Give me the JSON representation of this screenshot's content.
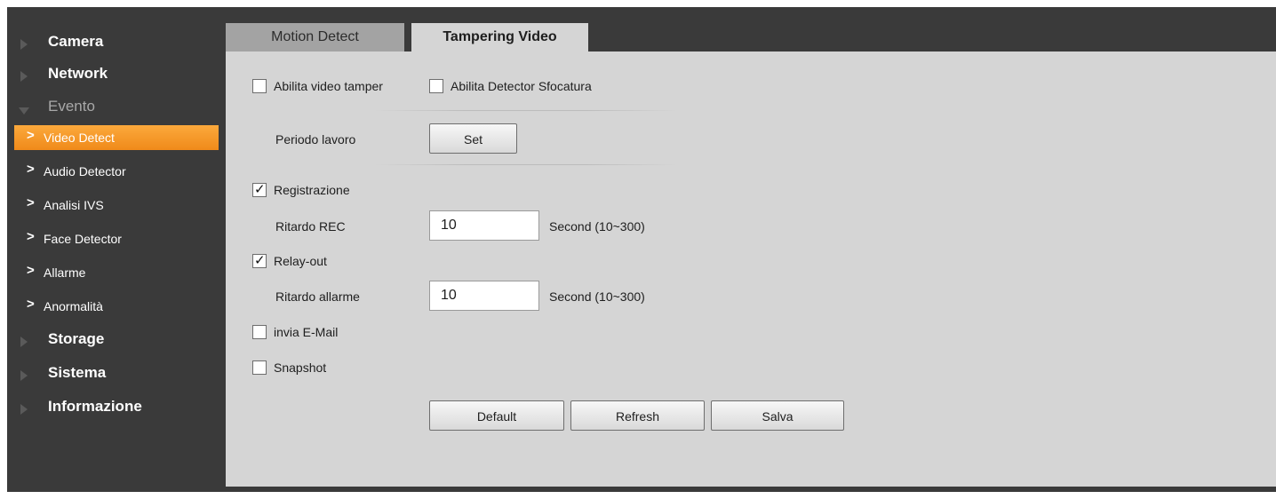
{
  "sidebar": {
    "top_items": [
      {
        "label": "Camera"
      },
      {
        "label": "Network"
      },
      {
        "label": "Evento"
      },
      {
        "label": "Storage"
      },
      {
        "label": "Sistema"
      },
      {
        "label": "Informazione"
      }
    ],
    "sub_items": [
      {
        "label": "Video Detect",
        "active": true
      },
      {
        "label": "Audio Detector"
      },
      {
        "label": "Analisi IVS"
      },
      {
        "label": "Face Detector"
      },
      {
        "label": "Allarme"
      },
      {
        "label": "Anormalità"
      }
    ]
  },
  "tabs": [
    {
      "label": "Motion Detect",
      "active": false
    },
    {
      "label": "Tampering Video",
      "active": true
    }
  ],
  "form": {
    "enable_tamper": {
      "label": "Abilita video tamper",
      "checked": false
    },
    "enable_blur": {
      "label": "Abilita Detector Sfocatura",
      "checked": false
    },
    "work_period": {
      "label": "Periodo lavoro",
      "button": "Set"
    },
    "record": {
      "label": "Registrazione",
      "checked": true
    },
    "rec_delay": {
      "label": "Ritardo REC",
      "value": "10",
      "unit": "Second (10~300)"
    },
    "relay_out": {
      "label": "Relay-out",
      "checked": true
    },
    "alarm_delay": {
      "label": "Ritardo allarme",
      "value": "10",
      "unit": "Second (10~300)"
    },
    "send_email": {
      "label": "invia E-Mail",
      "checked": false
    },
    "snapshot": {
      "label": "Snapshot",
      "checked": false
    }
  },
  "actions": {
    "default_label": "Default",
    "refresh_label": "Refresh",
    "save_label": "Salva"
  }
}
